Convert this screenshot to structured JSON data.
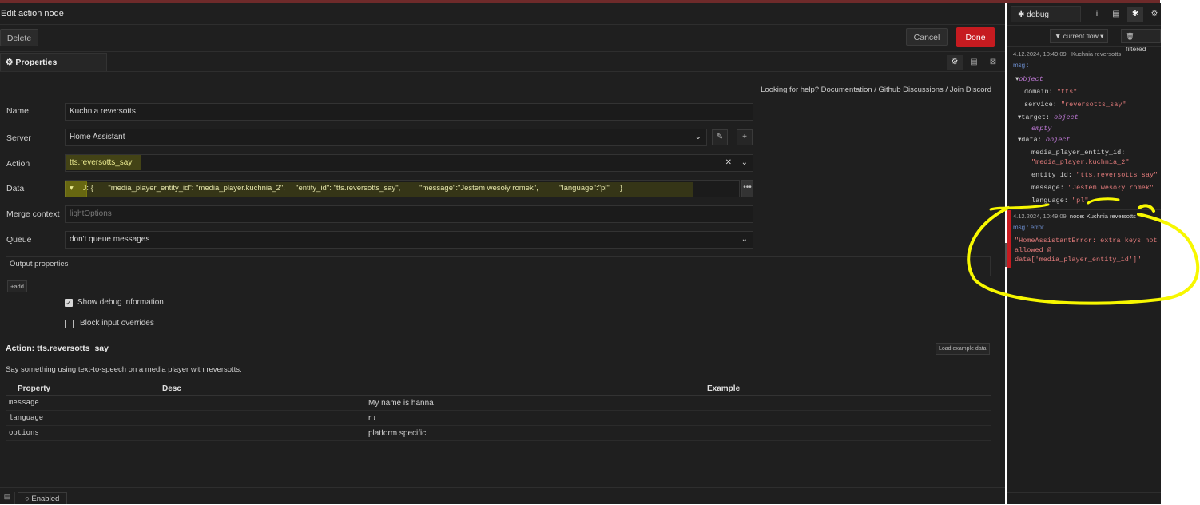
{
  "header": {
    "title": "Edit action node",
    "delete_label": "Delete",
    "cancel_label": "Cancel",
    "done_label": "Done"
  },
  "tabs": {
    "properties_label": "Properties"
  },
  "help": {
    "prefix": "Looking for help?",
    "documentation": "Documentation",
    "github": "Github Discussions",
    "discord": "Join Discord",
    "sep": "/"
  },
  "form": {
    "name_label": "Name",
    "name_value": "Kuchnia reversotts",
    "server_label": "Server",
    "server_value": "Home Assistant",
    "action_label": "Action",
    "action_value": "tts.reversotts_say",
    "data_label": "Data",
    "data_type": "J:",
    "data_value": "{       \"media_player_entity_id\": \"media_player.kuchnia_2\",     \"entity_id\": \"tts.reversotts_say\",         \"message\":\"Jestem wesoły romek\",          \"language\":\"pl\"     }",
    "merge_label": "Merge context",
    "merge_placeholder": "lightOptions",
    "queue_label": "Queue",
    "queue_value": "don't queue messages",
    "output_label": "Output properties",
    "add_label": "add",
    "show_debug_label": "Show debug information",
    "block_label": "Block input overrides"
  },
  "action_doc": {
    "title": "Action: tts.reversotts_say",
    "load_example": "Load example data",
    "description": "Say something using text-to-speech on a media player with reversotts.",
    "columns": [
      "Property",
      "Desc",
      "Example"
    ],
    "rows": [
      {
        "property": "message",
        "desc": "",
        "example": "My name is hanna"
      },
      {
        "property": "language",
        "desc": "",
        "example": "ru"
      },
      {
        "property": "options",
        "desc": "",
        "example": "platform specific"
      }
    ]
  },
  "footer": {
    "enabled_label": "Enabled"
  },
  "debug": {
    "tab_label": "debug",
    "filter_label": "current flow",
    "filtered_label": "filtered",
    "msg1": {
      "timestamp": "4.12.2024, 10:49:09",
      "source": "Kuchnia reversotts",
      "path": "msg :",
      "type": "object",
      "domain_k": "domain:",
      "domain_v": "\"tts\"",
      "service_k": "service:",
      "service_v": "\"reversotts_say\"",
      "target_k": "target:",
      "target_t": "object",
      "empty": "empty",
      "data_k": "data:",
      "data_t": "object",
      "mpe_k": "media_player_entity_id:",
      "mpe_v": "\"media_player.kuchnia_2\"",
      "eid_k": "entity_id:",
      "eid_v": "\"tts.reversotts_say\"",
      "msg_k": "message:",
      "msg_v": "\"Jestem wesoły romek\"",
      "lang_k": "language:",
      "lang_v": "\"pl\""
    },
    "msg2": {
      "timestamp": "4.12.2024, 10:49:09",
      "source": "node: Kuchnia reversotts",
      "path": "msg : error",
      "error": [
        "\"HomeAssistantError: extra keys not",
        "allowed @",
        "data['media_player_entity_id']\""
      ]
    }
  },
  "colors": {
    "accent": "#c61b20",
    "annotation": "#f7f700",
    "error": "#e07a7a"
  }
}
